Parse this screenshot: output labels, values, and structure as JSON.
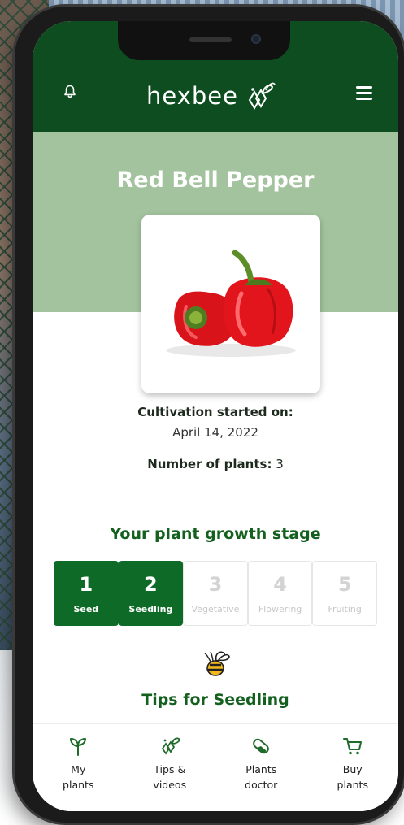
{
  "header": {
    "brand": "hexbee"
  },
  "plant": {
    "name": "Red Bell Pepper",
    "started_label": "Cultivation started on:",
    "started_date": "April 14, 2022",
    "count_label": "Number of plants:",
    "count_value": "3"
  },
  "growth": {
    "title": "Your plant growth stage",
    "stages": [
      {
        "num": "1",
        "name": "Seed",
        "active": true
      },
      {
        "num": "2",
        "name": "Seedling",
        "active": true
      },
      {
        "num": "3",
        "name": "Vegetative",
        "active": false
      },
      {
        "num": "4",
        "name": "Flowering",
        "active": false
      },
      {
        "num": "5",
        "name": "Fruiting",
        "active": false
      }
    ]
  },
  "tips": {
    "title": "Tips for Seedling"
  },
  "nav": {
    "items": [
      {
        "label": "My\nplants",
        "icon": "sprout-icon"
      },
      {
        "label": "Tips &\nvideos",
        "icon": "bee-icon"
      },
      {
        "label": "Plants\ndoctor",
        "icon": "pill-icon"
      },
      {
        "label": "Buy\nplants",
        "icon": "cart-icon"
      }
    ]
  },
  "colors": {
    "header_green": "#0e4d1f",
    "hero_green": "#a3c39e",
    "accent_green": "#0e6b27",
    "title_green": "#14601f"
  }
}
